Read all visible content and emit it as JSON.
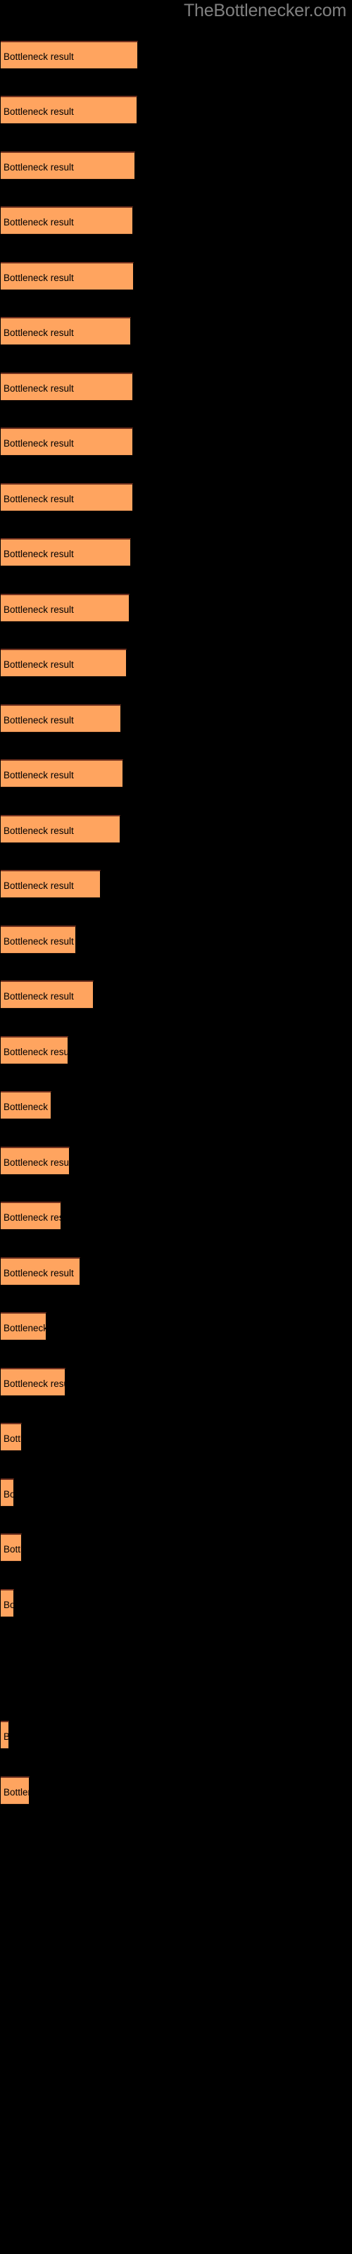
{
  "site": {
    "title": "TheBottlenecker.com",
    "title_color": "#808080"
  },
  "chart_data": {
    "type": "bar",
    "orientation": "horizontal",
    "title": "TheBottlenecker.com",
    "xlabel": "",
    "ylabel": "",
    "grid": false,
    "legend": false,
    "bar_color": "#ffa45f",
    "bar_edge_color": "#73321f",
    "background_color": "#000000",
    "label_color": "#000000",
    "bar_label": "Bottleneck result",
    "xlim": [
      0,
      500
    ],
    "value_unit": "px",
    "categories": [
      "Bottleneck result",
      "Bottleneck result",
      "Bottleneck result",
      "Bottleneck result",
      "Bottleneck result",
      "Bottleneck result",
      "Bottleneck result",
      "Bottleneck result",
      "Bottleneck result",
      "Bottleneck result",
      "Bottleneck result",
      "Bottleneck result",
      "Bottleneck result",
      "Bottleneck result",
      "Bottleneck result",
      "Bottleneck result",
      "Bottleneck result",
      "Bottleneck result",
      "Bottleneck result",
      "Bottleneck result",
      "Bottleneck result",
      "Bottleneck result",
      "Bottleneck result",
      "Bottleneck result",
      "Bottleneck result",
      "Bottleneck result",
      "Bottleneck result",
      "Bottleneck result",
      "Bottleneck result",
      "Bottleneck result",
      "Bottleneck result",
      "Bottleneck result"
    ],
    "values": [
      195,
      194,
      191,
      188,
      189,
      185,
      188,
      188,
      188,
      185,
      183,
      179,
      171,
      174,
      170,
      142,
      107,
      132,
      96,
      72,
      98,
      86,
      113,
      65,
      92,
      30,
      19,
      7,
      2,
      12,
      41,
      0
    ],
    "bars": [
      {
        "label": "Bottleneck result",
        "width": 195,
        "top": 58
      },
      {
        "label": "Bottleneck result",
        "width": 194,
        "top": 136
      },
      {
        "label": "Bottleneck result",
        "width": 191,
        "top": 215
      },
      {
        "label": "Bottleneck result",
        "width": 188,
        "top": 293
      },
      {
        "label": "Bottleneck result",
        "width": 189,
        "top": 372
      },
      {
        "label": "Bottleneck result",
        "width": 185,
        "top": 450
      },
      {
        "label": "Bottleneck result",
        "width": 188,
        "top": 529
      },
      {
        "label": "Bottleneck result",
        "width": 188,
        "top": 607
      },
      {
        "label": "Bottleneck result",
        "width": 188,
        "top": 686
      },
      {
        "label": "Bottleneck result",
        "width": 185,
        "top": 764
      },
      {
        "label": "Bottleneck result",
        "width": 183,
        "top": 843
      },
      {
        "label": "Bottleneck result",
        "width": 179,
        "top": 921
      },
      {
        "label": "Bottleneck result",
        "width": 171,
        "top": 1000
      },
      {
        "label": "Bottleneck result",
        "width": 174,
        "top": 1078
      },
      {
        "label": "Bottleneck result",
        "width": 170,
        "top": 1157
      },
      {
        "label": "Bottleneck result",
        "width": 142,
        "top": 1235
      },
      {
        "label": "Bottleneck result",
        "width": 107,
        "top": 1314
      },
      {
        "label": "Bottleneck result",
        "width": 132,
        "top": 1392
      },
      {
        "label": "Bottleneck result",
        "width": 96,
        "top": 1471
      },
      {
        "label": "Bottleneck result",
        "width": 72,
        "top": 1549
      },
      {
        "label": "Bottleneck result",
        "width": 98,
        "top": 1628
      },
      {
        "label": "Bottleneck result",
        "width": 86,
        "top": 1706
      },
      {
        "label": "Bottleneck result",
        "width": 113,
        "top": 1785
      },
      {
        "label": "Bottleneck result",
        "width": 65,
        "top": 1863
      },
      {
        "label": "Bottleneck result",
        "width": 92,
        "top": 1942
      },
      {
        "label": "Bottleneck result",
        "width": 30,
        "top": 2020
      },
      {
        "label": "Bottleneck result",
        "width": 19,
        "top": 2099
      },
      {
        "label": "Bottleneck result",
        "width": 30,
        "top": 2177
      },
      {
        "label": "Bottleneck result",
        "width": 19,
        "top": 2256
      },
      {
        "label": "Bottleneck result",
        "width": 12,
        "top": 2443
      },
      {
        "label": "Bottleneck result",
        "width": 41,
        "top": 2522
      },
      {
        "label": "Bottleneck result",
        "width": 0,
        "top": 2365
      }
    ]
  }
}
